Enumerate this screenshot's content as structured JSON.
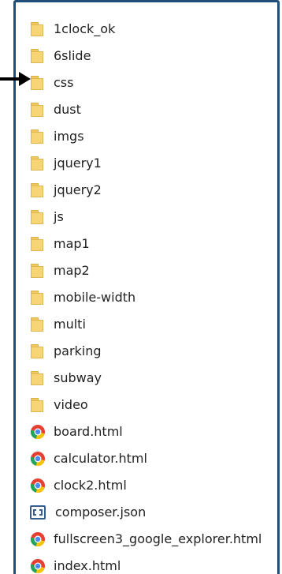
{
  "files": [
    {
      "name": "1clock_ok",
      "type": "folder",
      "icon": "folder-icon"
    },
    {
      "name": "6slide",
      "type": "folder",
      "icon": "folder-icon"
    },
    {
      "name": "css",
      "type": "folder",
      "icon": "folder-icon"
    },
    {
      "name": "dust",
      "type": "folder",
      "icon": "folder-icon"
    },
    {
      "name": "imgs",
      "type": "folder",
      "icon": "folder-icon"
    },
    {
      "name": "jquery1",
      "type": "folder",
      "icon": "folder-icon"
    },
    {
      "name": "jquery2",
      "type": "folder",
      "icon": "folder-icon"
    },
    {
      "name": "js",
      "type": "folder",
      "icon": "folder-icon"
    },
    {
      "name": "map1",
      "type": "folder",
      "icon": "folder-icon"
    },
    {
      "name": "map2",
      "type": "folder",
      "icon": "folder-icon"
    },
    {
      "name": "mobile-width",
      "type": "folder",
      "icon": "folder-icon"
    },
    {
      "name": "multi",
      "type": "folder",
      "icon": "folder-icon"
    },
    {
      "name": "parking",
      "type": "folder",
      "icon": "folder-icon"
    },
    {
      "name": "subway",
      "type": "folder",
      "icon": "folder-icon"
    },
    {
      "name": "video",
      "type": "folder",
      "icon": "folder-icon"
    },
    {
      "name": "board.html",
      "type": "html",
      "icon": "chrome-icon"
    },
    {
      "name": "calculator.html",
      "type": "html",
      "icon": "chrome-icon"
    },
    {
      "name": "clock2.html",
      "type": "html",
      "icon": "chrome-icon"
    },
    {
      "name": "composer.json",
      "type": "json",
      "icon": "json-file-icon"
    },
    {
      "name": "fullscreen3_google_explorer.html",
      "type": "html",
      "icon": "chrome-icon"
    },
    {
      "name": "index.html",
      "type": "html",
      "icon": "chrome-icon"
    }
  ],
  "pointer": {
    "icon": "arrow-right-icon",
    "target": "css"
  },
  "colors": {
    "frame_border": "#1f4e79",
    "folder": "#f7d575",
    "text": "#222222"
  }
}
